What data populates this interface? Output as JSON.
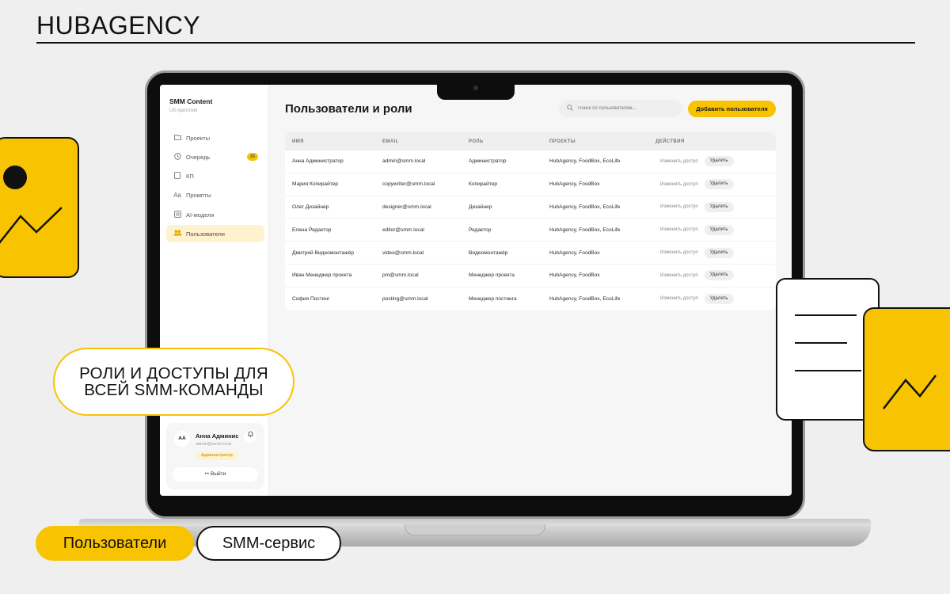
{
  "brand": "HUBAGENCY",
  "app": {
    "title": "SMM Content",
    "subtitle": "UX-прототип"
  },
  "nav": [
    {
      "label": "Проекты",
      "icon": "folder-icon"
    },
    {
      "label": "Очередь",
      "icon": "clock-icon",
      "badge": "25"
    },
    {
      "label": "КП",
      "icon": "doc-icon"
    },
    {
      "label": "Промпты",
      "icon": "text-icon"
    },
    {
      "label": "AI-модели",
      "icon": "chip-icon"
    },
    {
      "label": "Пользователи",
      "icon": "users-icon",
      "active": true
    }
  ],
  "user": {
    "initials": "AA",
    "name": "Анна Админис",
    "email": "admin@smm.local",
    "role": "Администратор",
    "logout": "Выйти"
  },
  "page": {
    "title": "Пользователи и роли",
    "search_placeholder": "Поиск по пользователям...",
    "add_button": "Добавить пользователя"
  },
  "table": {
    "headers": [
      "ИМЯ",
      "EMAIL",
      "РОЛЬ",
      "ПРОЕКТЫ",
      "ДЕЙСТВИЯ"
    ],
    "edit_label": "Изменить доступ",
    "delete_label": "Удалить",
    "rows": [
      {
        "name": "Анна Администратор",
        "email": "admin@smm.local",
        "role": "Администратор",
        "projects": "HubAgency, FoodBox, EcoLife"
      },
      {
        "name": "Мария Копирайтер",
        "email": "copywriter@smm.local",
        "role": "Копирайтер",
        "projects": "HubAgency, FoodBox"
      },
      {
        "name": "Олег Дизайнер",
        "email": "designer@smm.local",
        "role": "Дизайнер",
        "projects": "HubAgency, FoodBox, EcoLife"
      },
      {
        "name": "Елена Редактор",
        "email": "editor@smm.local",
        "role": "Редактор",
        "projects": "HubAgency, FoodBox, EcoLife"
      },
      {
        "name": "Дмитрий Видеомонтажёр",
        "email": "video@smm.local",
        "role": "Видеомонтажёр",
        "projects": "HubAgency, FoodBox"
      },
      {
        "name": "Иван Менеджер проекта",
        "email": "pm@smm.local",
        "role": "Менеджер проекта",
        "projects": "HubAgency, FoodBox"
      },
      {
        "name": "София Постинг",
        "email": "posting@smm.local",
        "role": "Менеджер постинга",
        "projects": "HubAgency, FoodBox, EcoLife"
      }
    ]
  },
  "callout": "РОЛИ И ДОСТУПЫ ДЛЯ ВСЕЙ SMM-КОМАНДЫ",
  "tags": {
    "primary": "Пользователи",
    "secondary": "SMM-сервис"
  },
  "colors": {
    "accent": "#f8c300",
    "active_bg": "#fff3cf"
  }
}
